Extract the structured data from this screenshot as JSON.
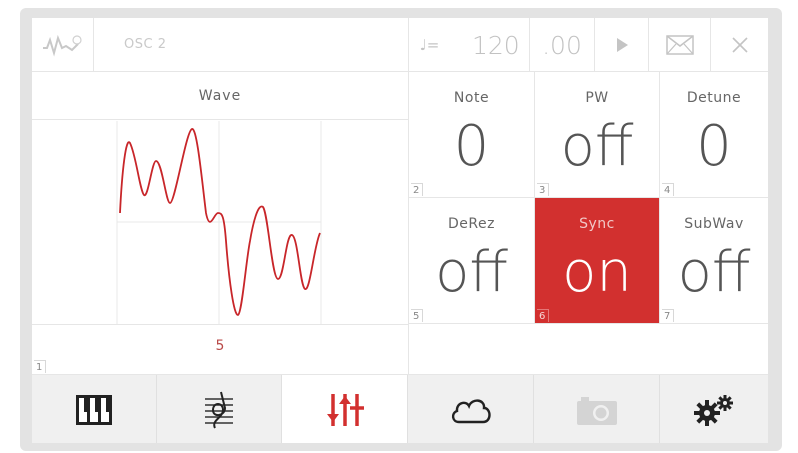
{
  "titlebar": {
    "logo_icon": "waveform-logo-icon",
    "oscillator_name": "OSC 2",
    "tempo_icon": "quarter-note-icon",
    "tempo_symbol": "♩=",
    "tempo_integer": "120",
    "tempo_fraction": ".00",
    "play_icon": "play-icon",
    "mail_icon": "envelope-icon",
    "close_icon": "close-icon"
  },
  "wave": {
    "label": "Wave",
    "value": "5",
    "index": "1",
    "color": "#c8262a"
  },
  "params": [
    {
      "label": "Note",
      "value": "0",
      "index": "2",
      "active": false
    },
    {
      "label": "PW",
      "value": "off",
      "index": "3",
      "active": false
    },
    {
      "label": "Detune",
      "value": "0",
      "index": "4",
      "active": false
    },
    {
      "label": "DeRez",
      "value": "off",
      "index": "5",
      "active": false
    },
    {
      "label": "Sync",
      "value": "on",
      "index": "6",
      "active": true
    },
    {
      "label": "SubWav",
      "value": "off",
      "index": "7",
      "active": false
    }
  ],
  "accent_color": "#d2302f",
  "bottom_tabs": [
    {
      "icon": "piano-keys-icon",
      "selected": false
    },
    {
      "icon": "sheet-music-icon",
      "selected": false
    },
    {
      "icon": "sliders-icon",
      "selected": true
    },
    {
      "icon": "cloud-icon",
      "selected": false
    },
    {
      "icon": "camera-icon",
      "selected": false
    },
    {
      "icon": "gears-icon",
      "selected": false
    }
  ]
}
